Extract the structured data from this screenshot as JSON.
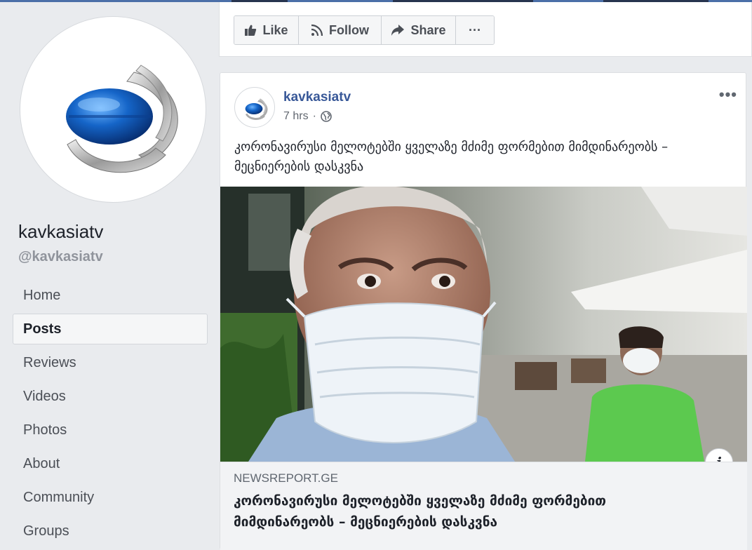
{
  "page": {
    "name": "kavkasiatv",
    "handle": "@kavkasiatv",
    "logo_icon": "kavkasia-tv-logo"
  },
  "nav": {
    "items": [
      {
        "label": "Home",
        "active": false
      },
      {
        "label": "Posts",
        "active": true
      },
      {
        "label": "Reviews",
        "active": false
      },
      {
        "label": "Videos",
        "active": false
      },
      {
        "label": "Photos",
        "active": false
      },
      {
        "label": "About",
        "active": false
      },
      {
        "label": "Community",
        "active": false
      },
      {
        "label": "Groups",
        "active": false
      }
    ]
  },
  "actions": {
    "like_label": "Like",
    "follow_label": "Follow",
    "share_label": "Share",
    "more_label": "···"
  },
  "post": {
    "author": "kavkasiatv",
    "time": "7 hrs",
    "separator": "·",
    "privacy_icon": "globe-icon",
    "menu_label": "•••",
    "text": "კორონავირუსი მელოტებში ყველაზე მძიმე ფორმებით მიმდინარეობს – მეცნიერების დასკვნა",
    "image_alt": "Elderly man wearing a surgical face mask at an outdoor cafe, woman in green shirt with mask in background",
    "info_label": "i",
    "link": {
      "domain": "NEWSREPORT.GE",
      "title": "კორონავირუსი მელოტებში ყველაზე მძიმე ფორმებით მიმდინარეობს – მეცნიერების დასკვნა"
    }
  },
  "colors": {
    "background": "#e9ebee",
    "link_blue": "#385898",
    "top_bar": "#4b6fa8"
  }
}
